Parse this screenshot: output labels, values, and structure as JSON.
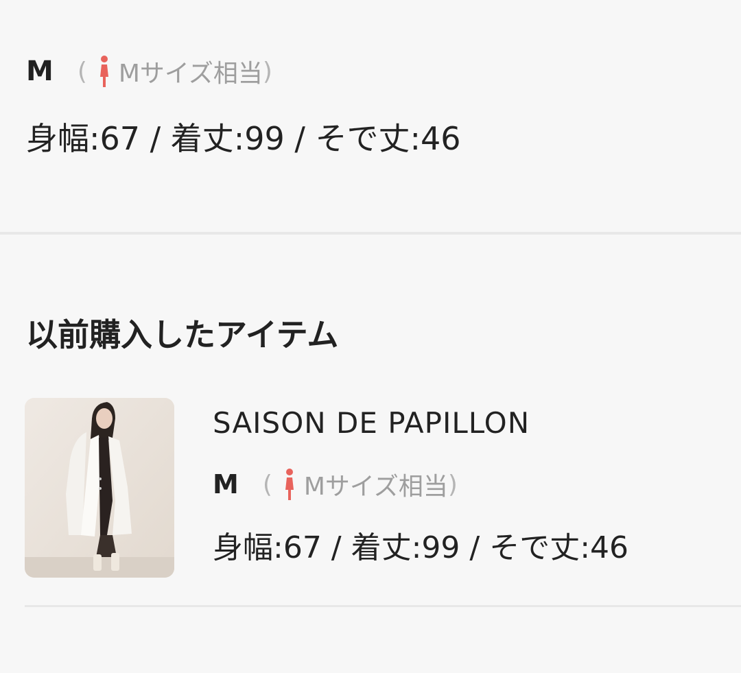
{
  "current_size": {
    "size": "M",
    "paren_open": "(",
    "equivalent": "Mサイズ相当",
    "paren_close": ")",
    "measurements": "身幅:67 / 着丈:99 / そで丈:46"
  },
  "previous_items": {
    "title": "以前購入したアイテム",
    "items": [
      {
        "brand": "SAISON DE PAPILLON",
        "size": "M",
        "paren_open": "(",
        "equivalent": "Mサイズ相当",
        "paren_close": ")",
        "measurements": "身幅:67 / 着丈:99 / そで丈:46"
      }
    ]
  },
  "colors": {
    "background": "#f7f7f7",
    "text": "#222222",
    "muted": "#9e9e9e",
    "person_icon": "#e8635c",
    "divider": "#e8e8e8"
  },
  "icons": {
    "size_person": "female-person-icon",
    "item_image": "white-coat-product-photo"
  }
}
